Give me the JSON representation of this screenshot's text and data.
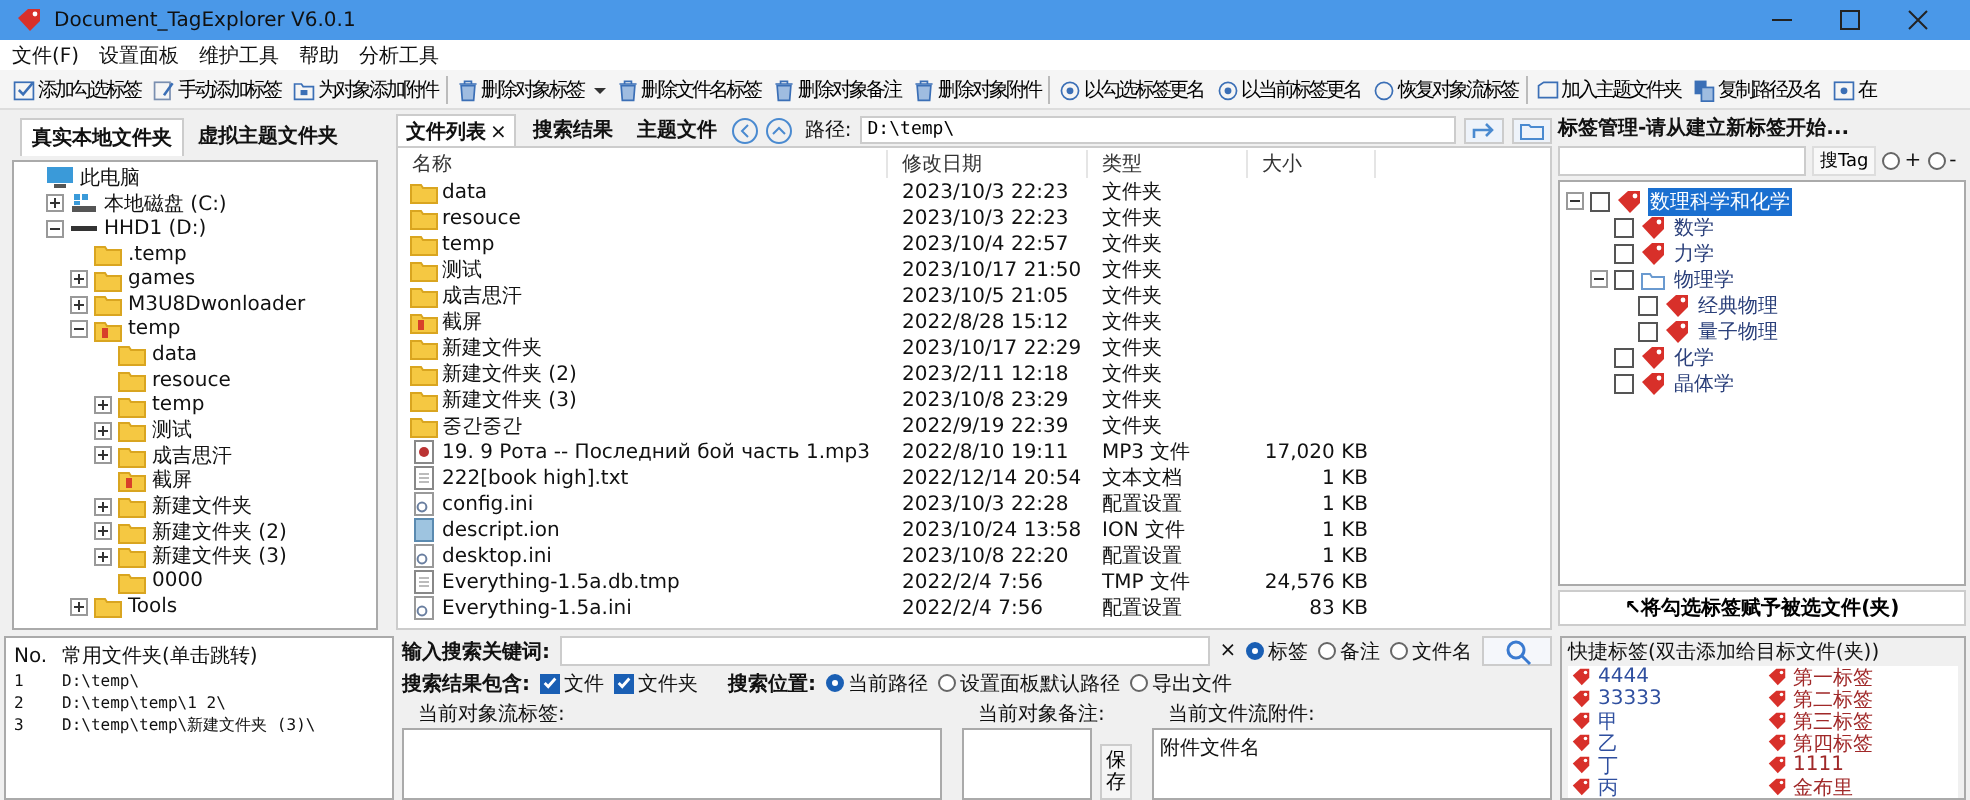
{
  "window": {
    "title": "Document_TagExplorer  V6.0.1"
  },
  "menu": [
    "文件(F)",
    "设置面板",
    "维护工具",
    "帮助",
    "分析工具"
  ],
  "toolbar": [
    {
      "kind": "check",
      "label": "添加勾选标签"
    },
    {
      "kind": "edit",
      "label": "手动添加标签"
    },
    {
      "kind": "attach",
      "label": "为对象添加附件"
    },
    {
      "kind": "separator"
    },
    {
      "kind": "trash",
      "label": "删除对象标签"
    },
    {
      "kind": "dropdown"
    },
    {
      "kind": "trash",
      "label": "删除文件名标签"
    },
    {
      "kind": "trash",
      "label": "删除对象备注"
    },
    {
      "kind": "trash",
      "label": "删除对象附件"
    },
    {
      "kind": "separator"
    },
    {
      "kind": "rename",
      "label": "以勾选标签更名"
    },
    {
      "kind": "rename",
      "label": "以当前标签更名"
    },
    {
      "kind": "restore",
      "label": "恢复对象流标签"
    },
    {
      "kind": "separator"
    },
    {
      "kind": "folder",
      "label": "加入主题文件夹"
    },
    {
      "kind": "copy",
      "label": "复制路径及名"
    },
    {
      "kind": "locate",
      "label": "在"
    }
  ],
  "left_panel": {
    "tabs": [
      {
        "label": "真实本地文件夹",
        "selected": true
      },
      {
        "label": "虚拟主题文件夹",
        "selected": false
      }
    ],
    "tree": [
      {
        "label": "此电脑",
        "kind": "pc",
        "children": [
          {
            "label": "本地磁盘 (C:)",
            "kind": "drive-c",
            "expanded": false
          },
          {
            "label": "HHD1 (D:)",
            "kind": "drive",
            "expanded": true,
            "children": [
              {
                "label": ".temp",
                "kind": "folder"
              },
              {
                "label": "games",
                "kind": "folder",
                "expanded": false
              },
              {
                "label": "M3U8Dwonloader",
                "kind": "folder",
                "expanded": false
              },
              {
                "label": "temp",
                "kind": "folder-marked",
                "expanded": true,
                "children": [
                  {
                    "label": "data",
                    "kind": "folder"
                  },
                  {
                    "label": "resouce",
                    "kind": "folder"
                  },
                  {
                    "label": "temp",
                    "kind": "folder",
                    "expanded": false
                  },
                  {
                    "label": "测试",
                    "kind": "folder",
                    "expanded": false
                  },
                  {
                    "label": "成吉思汗",
                    "kind": "folder",
                    "expanded": false
                  },
                  {
                    "label": "截屏",
                    "kind": "folder-marked"
                  },
                  {
                    "label": "新建文件夹",
                    "kind": "folder",
                    "expanded": false
                  },
                  {
                    "label": "新建文件夹 (2)",
                    "kind": "folder",
                    "expanded": false
                  },
                  {
                    "label": "新建文件夹 (3)",
                    "kind": "folder",
                    "expanded": false
                  },
                  {
                    "label": "0000",
                    "kind": "folder"
                  }
                ]
              },
              {
                "label": "Tools",
                "kind": "folder",
                "expanded": false
              }
            ]
          }
        ]
      }
    ]
  },
  "file_panel": {
    "tabs": [
      {
        "label": "文件列表",
        "selected": true,
        "close": "×"
      },
      {
        "label": "搜索结果",
        "selected": false
      },
      {
        "label": "主题文件",
        "selected": false
      }
    ],
    "path_label": "路径:",
    "path": "D:\\temp\\",
    "columns": [
      "名称",
      "修改日期",
      "类型",
      "大小"
    ],
    "rows": [
      {
        "kind": "folder",
        "name": "data",
        "date": "2023/10/3 22:23",
        "type": "文件夹"
      },
      {
        "kind": "folder",
        "name": "resouce",
        "date": "2023/10/3 22:23",
        "type": "文件夹"
      },
      {
        "kind": "folder",
        "name": "temp",
        "date": "2023/10/4 22:57",
        "type": "文件夹"
      },
      {
        "kind": "folder",
        "name": "测试",
        "date": "2023/10/17 21:50",
        "type": "文件夹"
      },
      {
        "kind": "folder",
        "name": "成吉思汗",
        "date": "2023/10/5 21:05",
        "type": "文件夹"
      },
      {
        "kind": "folder-marked",
        "name": "截屏",
        "date": "2022/8/28 15:12",
        "type": "文件夹"
      },
      {
        "kind": "folder",
        "name": "新建文件夹",
        "date": "2023/10/17 22:29",
        "type": "文件夹"
      },
      {
        "kind": "folder",
        "name": "新建文件夹 (2)",
        "date": "2023/2/11 12:18",
        "type": "文件夹"
      },
      {
        "kind": "folder",
        "name": "新建文件夹 (3)",
        "date": "2023/10/8 23:29",
        "type": "文件夹"
      },
      {
        "kind": "folder",
        "name": "중간중간",
        "date": "2022/9/19 22:39",
        "type": "文件夹"
      },
      {
        "kind": "audio",
        "name": "19. 9 Рота -- Последний бой часть 1.mp3",
        "date": "2022/8/10 19:11",
        "type": "MP3 文件",
        "size": "17,020 KB"
      },
      {
        "kind": "text",
        "name": "222[book high].txt",
        "date": "2022/12/14 20:54",
        "type": "文本文档",
        "size": "1 KB"
      },
      {
        "kind": "settings",
        "name": "config.ini",
        "date": "2023/10/3 22:28",
        "type": "配置设置",
        "size": "1 KB"
      },
      {
        "kind": "data",
        "name": "descript.ion",
        "date": "2023/10/24 13:58",
        "type": "ION 文件",
        "size": "1 KB"
      },
      {
        "kind": "settings",
        "name": "desktop.ini",
        "date": "2023/10/8 22:20",
        "type": "配置设置",
        "size": "1 KB"
      },
      {
        "kind": "text",
        "name": "Everything-1.5a.db.tmp",
        "date": "2022/2/4 7:56",
        "type": "TMP 文件",
        "size": "24,576 KB"
      },
      {
        "kind": "settings",
        "name": "Everything-1.5a.ini",
        "date": "2022/2/4 7:56",
        "type": "配置设置",
        "size": "83 KB"
      }
    ]
  },
  "tag_panel": {
    "title": "标签管理-请从建立新标签开始...",
    "search_button": "搜Tag",
    "modes": [
      {
        "label": "+",
        "selected": false
      },
      {
        "label": "-",
        "selected": false
      }
    ],
    "tree": [
      {
        "label": "数理科学和化学",
        "kind": "tag",
        "checked": false,
        "selected": true,
        "expanded": true,
        "children": [
          {
            "label": "数学",
            "kind": "tag",
            "checked": false,
            "selected": false
          },
          {
            "label": "力学",
            "kind": "tag",
            "checked": false,
            "selected": false
          },
          {
            "label": "物理学",
            "kind": "folder",
            "checked": false,
            "selected": false,
            "expanded": true,
            "children": [
              {
                "label": "经典物理",
                "kind": "tag",
                "checked": false,
                "selected": false
              },
              {
                "label": "量子物理",
                "kind": "tag",
                "checked": false,
                "selected": false
              }
            ]
          },
          {
            "label": "化学",
            "kind": "tag",
            "checked": false,
            "selected": false
          },
          {
            "label": "晶体学",
            "kind": "tag",
            "checked": false,
            "selected": false
          }
        ]
      }
    ],
    "apply_button": "↖将勾选标签赋予被选文件(夹)"
  },
  "favorites": {
    "columns": [
      "No.",
      "常用文件夹(单击跳转)"
    ],
    "rows": [
      [
        "1",
        "D:\\temp\\"
      ],
      [
        "2",
        "D:\\temp\\temp\\1 2\\"
      ],
      [
        "3",
        "D:\\temp\\temp\\新建文件夹 (3)\\"
      ]
    ]
  },
  "search": {
    "label": "输入搜索关键词:",
    "clear": "×",
    "scopes": [
      {
        "label": "标签",
        "selected": true
      },
      {
        "label": "备注",
        "selected": false
      },
      {
        "label": "文件名",
        "selected": false
      }
    ],
    "include_label": "搜索结果包含:",
    "include": [
      {
        "label": "文件",
        "checked": true
      },
      {
        "label": "文件夹",
        "checked": true
      }
    ],
    "location_label": "搜索位置:",
    "locations": [
      {
        "label": "当前路径",
        "selected": true
      },
      {
        "label": "设置面板默认路径",
        "selected": false
      },
      {
        "label": "导出文件",
        "selected": false
      }
    ]
  },
  "stream_tags": {
    "label": "当前对象流标签:"
  },
  "notes": {
    "label": "当前对象备注:",
    "save_button": "保存"
  },
  "attachments": {
    "label": "当前文件流附件:",
    "column": "附件文件名"
  },
  "quick_tags": {
    "title": "快捷标签(双击添加给目标文件(夹))",
    "items": [
      {
        "label": "4444",
        "color": "#2f4f9f"
      },
      {
        "label": "第一标签",
        "color": "#a02828"
      },
      {
        "label": "33333",
        "color": "#2f4f9f"
      },
      {
        "label": "第二标签",
        "color": "#a02828"
      },
      {
        "label": "甲",
        "color": "#2f4f9f"
      },
      {
        "label": "第三标签",
        "color": "#a02828"
      },
      {
        "label": "乙",
        "color": "#2f4f9f"
      },
      {
        "label": "第四标签",
        "color": "#a02828"
      },
      {
        "label": "丁",
        "color": "#2f4f9f"
      },
      {
        "label": "1111",
        "color": "#a02828"
      },
      {
        "label": "丙",
        "color": "#2f4f9f"
      },
      {
        "label": "金布里",
        "color": "#a02828"
      }
    ]
  }
}
